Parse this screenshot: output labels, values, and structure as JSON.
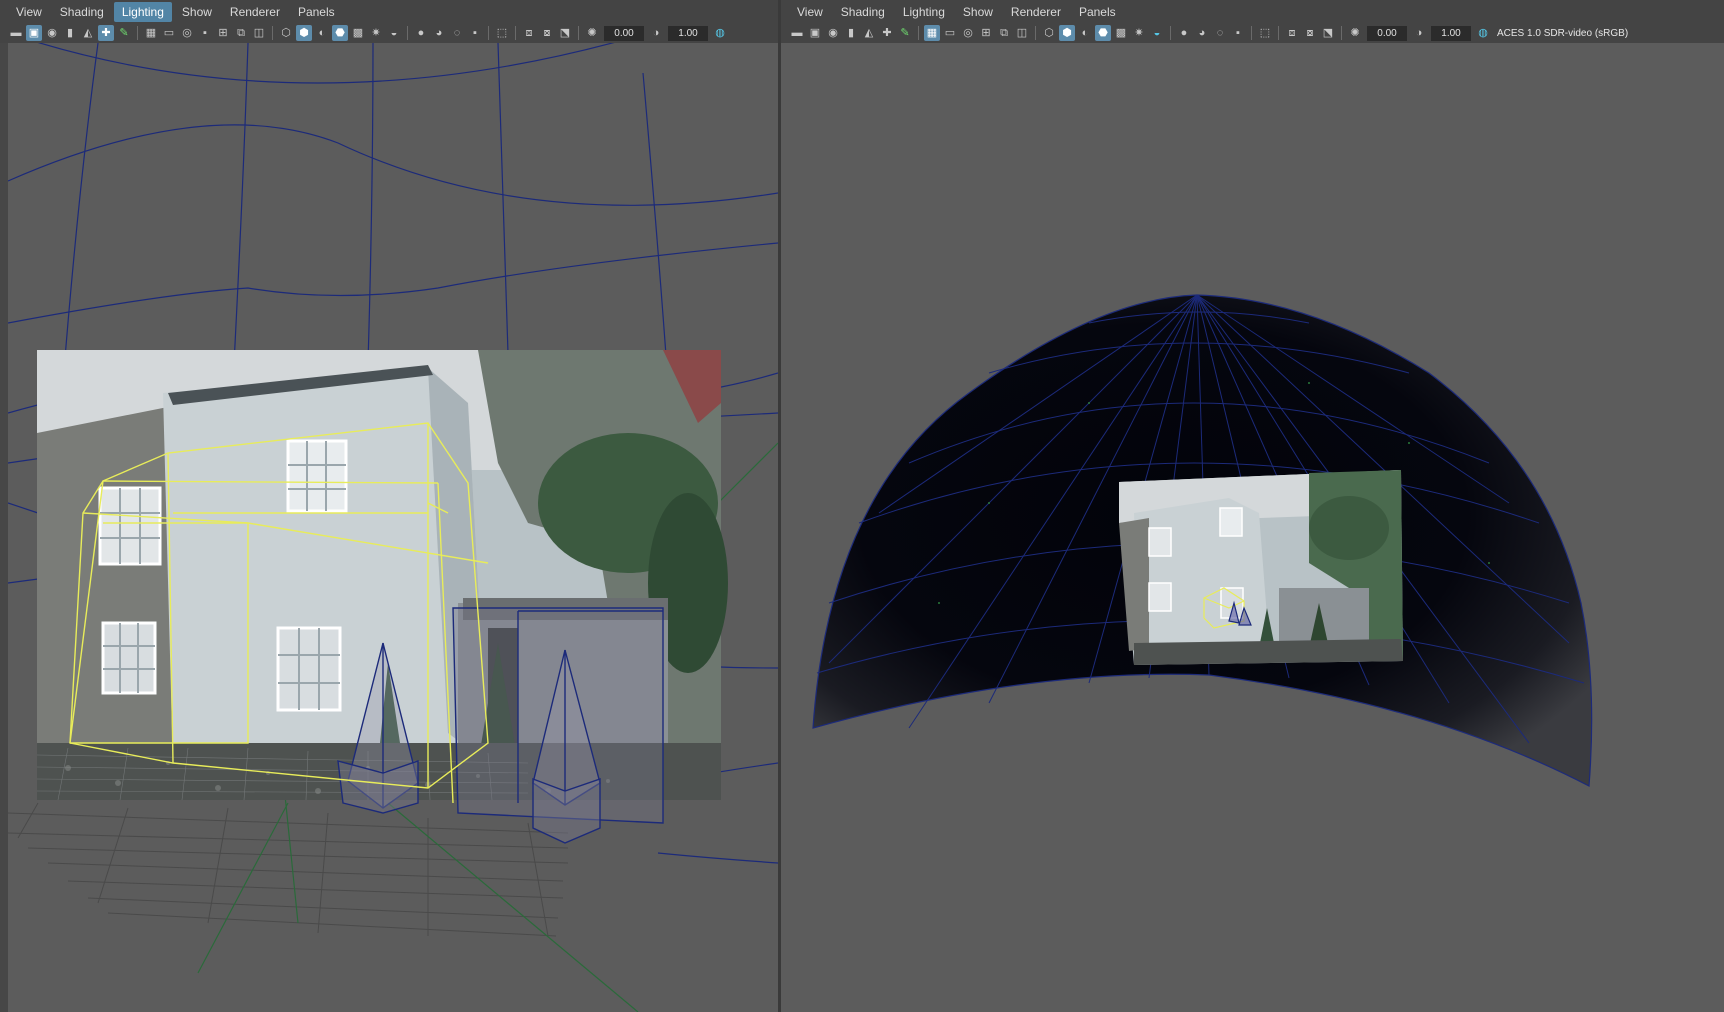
{
  "left_panel": {
    "menu": [
      "View",
      "Shading",
      "Lighting",
      "Show",
      "Renderer",
      "Panels"
    ],
    "active_menu": "Lighting",
    "exposure": "0.00",
    "gamma": "1.00"
  },
  "right_panel": {
    "menu": [
      "View",
      "Shading",
      "Lighting",
      "Show",
      "Renderer",
      "Panels"
    ],
    "exposure": "0.00",
    "gamma": "1.00",
    "color_space": "ACES 1.0 SDR-video (sRGB)"
  },
  "icons": [
    "camera-icon",
    "bookmark-icon",
    "grid-icon",
    "wireframe-icon",
    "smooth-shade-icon",
    "lights-icon",
    "shadows-icon",
    "isolate-icon",
    "exposure-icon",
    "gamma-icon",
    "color-management-icon"
  ],
  "colors": {
    "viewport_bg": "#5c5c5c",
    "wire_blue": "#1c2a7a",
    "selection_yellow": "#e8ec5a",
    "axis_green": "#2a6a3a",
    "menu_highlight": "#5285a6"
  }
}
